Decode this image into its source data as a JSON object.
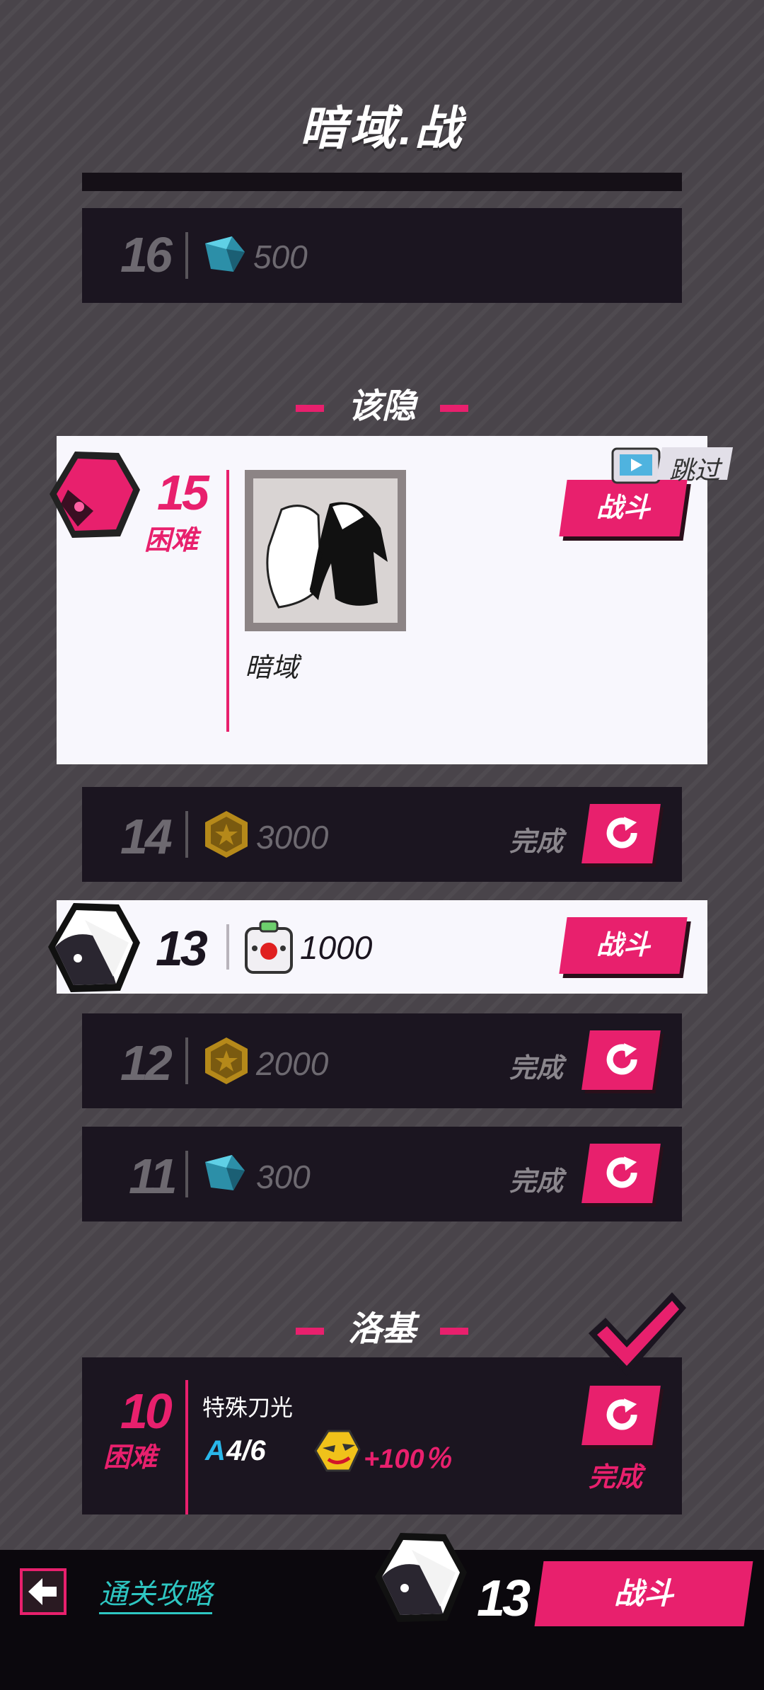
{
  "title": "暗域.战",
  "row16": {
    "level": "16",
    "reward": "500",
    "reward_icon": "gem-icon"
  },
  "sections": {
    "first": "该隐",
    "second": "洛基"
  },
  "skip_label": "跳过",
  "featured": {
    "level": "15",
    "difficulty": "困难",
    "fight_label": "战斗",
    "item_caption": "暗域"
  },
  "row14": {
    "level": "14",
    "reward": "3000",
    "reward_icon": "coin-icon",
    "status": "完成"
  },
  "row13": {
    "level": "13",
    "reward": "1000",
    "reward_icon": "box-icon",
    "fight_label": "战斗"
  },
  "row12": {
    "level": "12",
    "reward": "2000",
    "reward_icon": "coin-icon",
    "status": "完成"
  },
  "row11": {
    "level": "11",
    "reward": "300",
    "reward_icon": "gem-icon",
    "status": "完成"
  },
  "row10": {
    "level": "10",
    "difficulty": "困难",
    "skill": "特殊刀光",
    "grade": "A",
    "progress": "4/6",
    "bonus": "+100％",
    "status": "完成"
  },
  "footer": {
    "guide_label": "通关攻略",
    "current_level": "13",
    "fight_label": "战斗"
  },
  "colors": {
    "accent": "#e8206d",
    "row_bg": "#1b1520",
    "page_bg": "#49444a"
  }
}
